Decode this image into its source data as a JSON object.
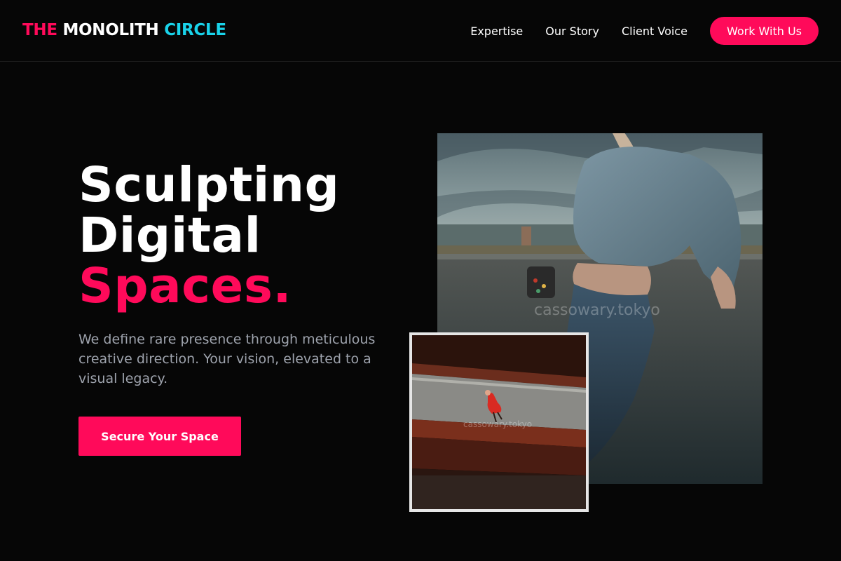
{
  "header": {
    "logo": {
      "word1": "THE",
      "word2": "MONOLITH",
      "word3": "CIRCLE"
    },
    "nav": [
      {
        "label": "Expertise"
      },
      {
        "label": "Our Story"
      },
      {
        "label": "Client Voice"
      }
    ],
    "cta_label": "Work With Us"
  },
  "hero": {
    "title_line1": "Sculpting",
    "title_line2": "Digital",
    "title_accent": "Spaces.",
    "description": "We define rare presence through meticulous creative direction. Your vision, elevated to a visual legacy.",
    "button_label": "Secure Your Space"
  },
  "images": {
    "main_watermark": "cassowary.tokyo",
    "small_watermark": "cassowary.tokyo"
  },
  "colors": {
    "accent_pink": "#ff0a5a",
    "accent_cyan": "#19d3ea",
    "background": "#060606",
    "muted_text": "#9ea3ad"
  }
}
